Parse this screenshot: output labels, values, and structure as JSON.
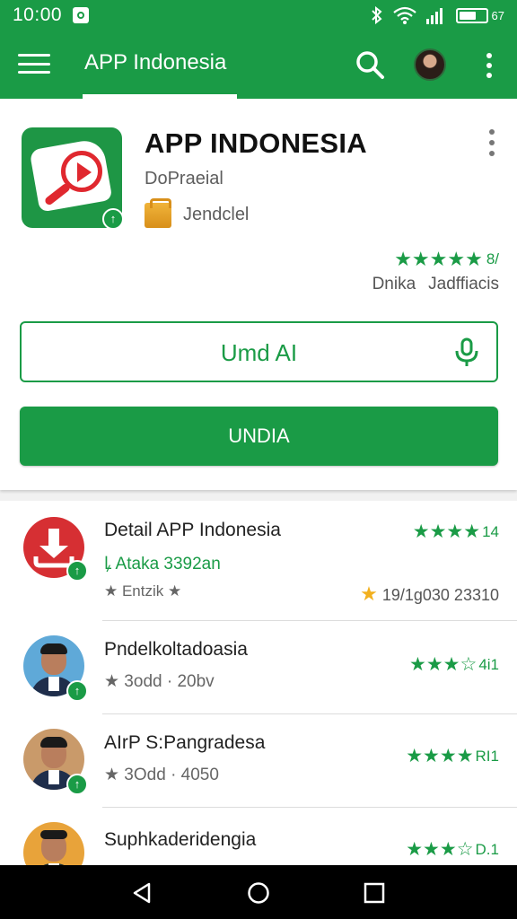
{
  "status": {
    "time": "10:00",
    "battery_label": "67",
    "battery_level": 0.67
  },
  "app_bar": {
    "title": "APP Indonesia"
  },
  "main": {
    "app_name": "APP INDONESIA",
    "developer": "DoPraeial",
    "category": "Jendclel",
    "rating": "★★★★★",
    "rating_count": "8/",
    "meta_1": "Dnika",
    "meta_2": "Jadffiacis",
    "outline_button": "Umd AI",
    "solid_button": "UNDIA"
  },
  "list": [
    {
      "title": "Detail APP Indonesia",
      "sub1": "ꝲ Ataka  3392an",
      "sub2_left": "★ Entzik ★",
      "sub2_right": "19/1g030 23310",
      "stars": "★★★★",
      "count": "14"
    },
    {
      "title": "Pndelkoltadoasia",
      "sub1": "★ 3odd · 20bv",
      "stars": "★★★☆",
      "count": "4i1"
    },
    {
      "title": "AIrP S:Pangradesa",
      "sub1": "★ 3Odd · 4050",
      "stars": "★★★★",
      "count": "RI1"
    },
    {
      "title": "Suphkaderidengia",
      "sub1": "",
      "stars": "★★★☆",
      "count": "D.1"
    }
  ],
  "colors": {
    "brand_green": "#1a9b46",
    "accent_red": "#e0282f"
  },
  "icons": [
    "hamburger-icon",
    "search-icon",
    "overflow-icon",
    "mic-icon",
    "back-icon",
    "home-icon",
    "recents-icon",
    "update-badge-icon"
  ]
}
